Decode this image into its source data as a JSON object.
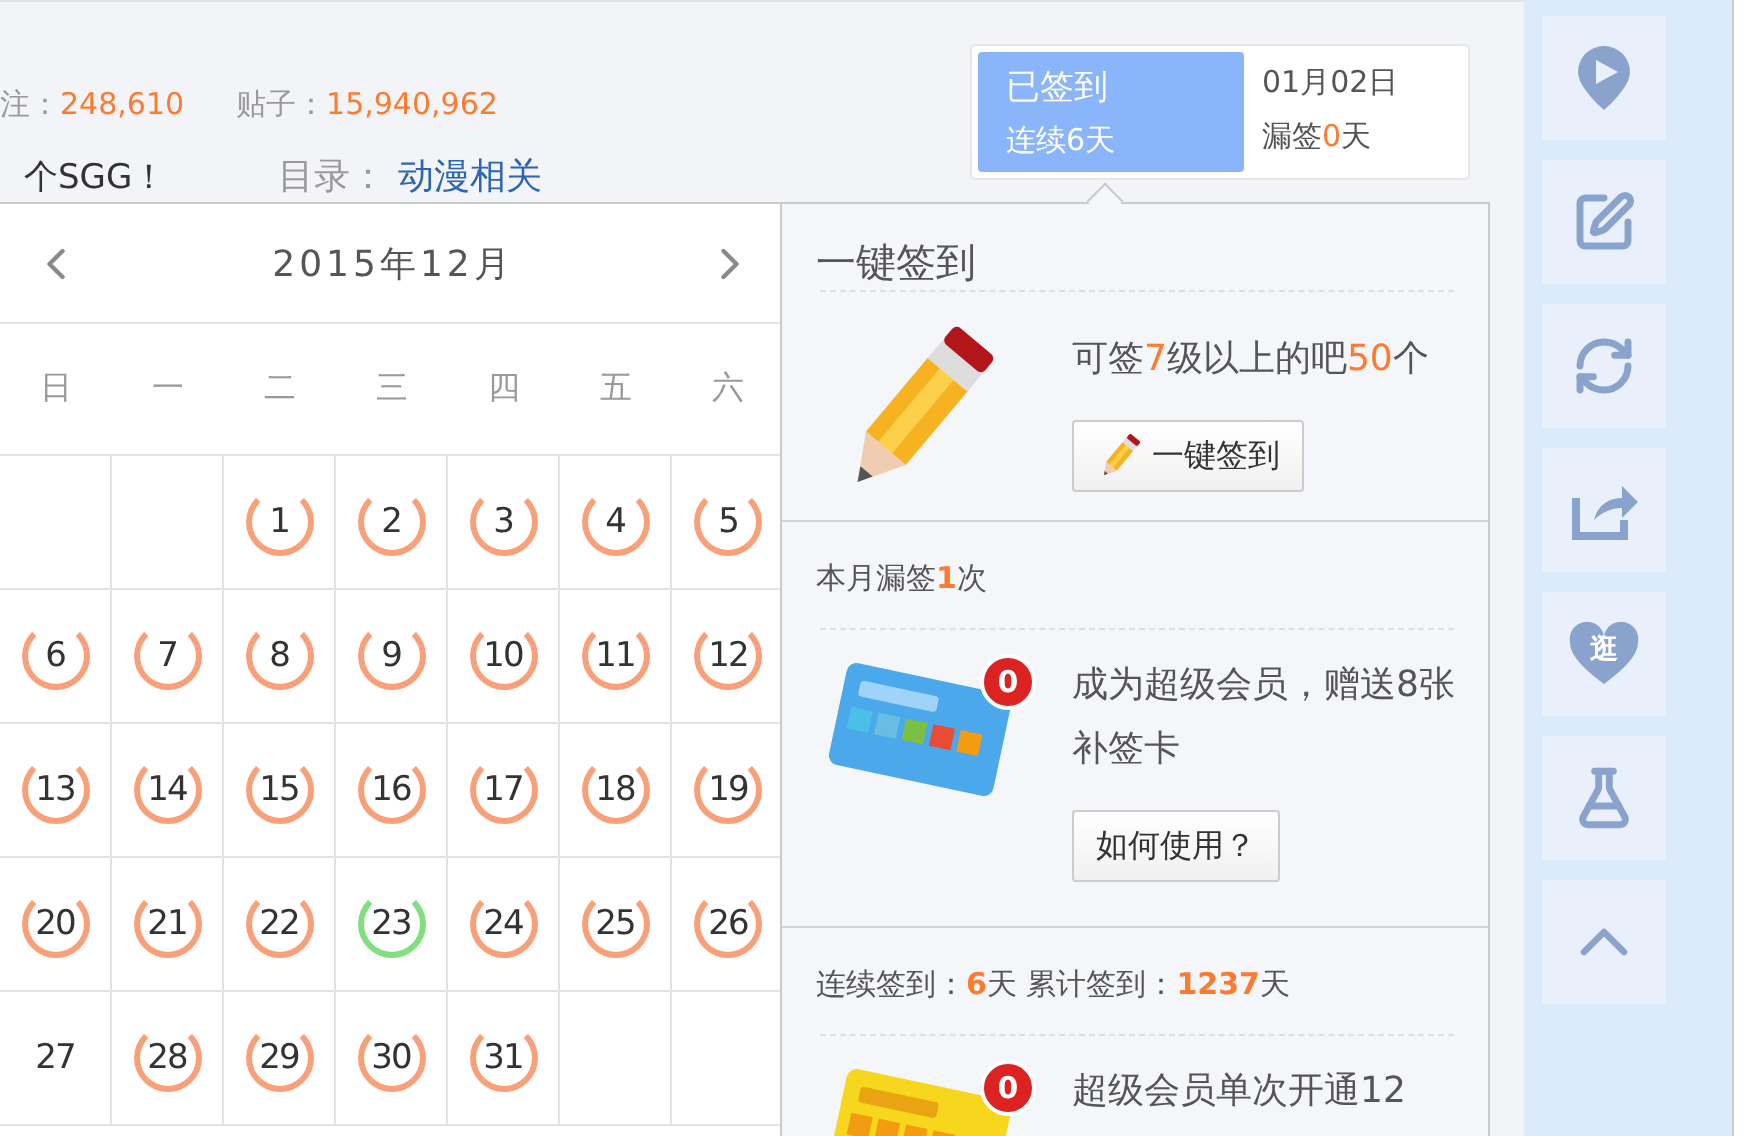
{
  "forum_stats": {
    "members_label": "注：",
    "members": "248,610",
    "posts_label": "贴子：",
    "posts": "15,940,962"
  },
  "forum_info": {
    "slogan": "个SGG！",
    "category_label": "目录：",
    "category": "动漫相关"
  },
  "sign_in": {
    "signed": true,
    "status": "已签到",
    "streak": "连续6天",
    "date": "01月02日",
    "missed": [
      {
        "text": "漏签",
        "highlight": false
      },
      {
        "text": "0",
        "highlight": true
      },
      {
        "text": "天",
        "highlight": false
      }
    ]
  },
  "calendar": {
    "title": "2015年12月",
    "weekdays": [
      "日",
      "一",
      "二",
      "三",
      "四",
      "五",
      "六"
    ],
    "weeks": [
      [
        {
          "kind": "blank"
        },
        {
          "kind": "blank"
        },
        {
          "kind": "day",
          "day": "1",
          "signed": true,
          "color": "#f9a079"
        },
        {
          "kind": "day",
          "day": "2",
          "signed": true,
          "color": "#f9a079"
        },
        {
          "kind": "day",
          "day": "3",
          "signed": true,
          "color": "#f9a079"
        },
        {
          "kind": "day",
          "day": "4",
          "signed": true,
          "color": "#f9a079"
        },
        {
          "kind": "day",
          "day": "5",
          "signed": true,
          "color": "#f9a079"
        }
      ],
      [
        {
          "kind": "day",
          "day": "6",
          "signed": true,
          "color": "#f9a079"
        },
        {
          "kind": "day",
          "day": "7",
          "signed": true,
          "color": "#f9a079"
        },
        {
          "kind": "day",
          "day": "8",
          "signed": true,
          "color": "#f9a079"
        },
        {
          "kind": "day",
          "day": "9",
          "signed": true,
          "color": "#f9a079"
        },
        {
          "kind": "day",
          "day": "10",
          "signed": true,
          "color": "#f9a079"
        },
        {
          "kind": "day",
          "day": "11",
          "signed": true,
          "color": "#f9a079"
        },
        {
          "kind": "day",
          "day": "12",
          "signed": true,
          "color": "#f9a079"
        }
      ],
      [
        {
          "kind": "day",
          "day": "13",
          "signed": true,
          "color": "#f9a079"
        },
        {
          "kind": "day",
          "day": "14",
          "signed": true,
          "color": "#f9a079"
        },
        {
          "kind": "day",
          "day": "15",
          "signed": true,
          "color": "#f9a079"
        },
        {
          "kind": "day",
          "day": "16",
          "signed": true,
          "color": "#f9a079"
        },
        {
          "kind": "day",
          "day": "17",
          "signed": true,
          "color": "#f9a079"
        },
        {
          "kind": "day",
          "day": "18",
          "signed": true,
          "color": "#f9a079"
        },
        {
          "kind": "day",
          "day": "19",
          "signed": true,
          "color": "#f9a079"
        }
      ],
      [
        {
          "kind": "day",
          "day": "20",
          "signed": true,
          "color": "#f9a079"
        },
        {
          "kind": "day",
          "day": "21",
          "signed": true,
          "color": "#f9a079"
        },
        {
          "kind": "day",
          "day": "22",
          "signed": true,
          "color": "#f9a079"
        },
        {
          "kind": "day",
          "day": "23",
          "signed": true,
          "color": "#80e080"
        },
        {
          "kind": "day",
          "day": "24",
          "signed": true,
          "color": "#f9a079"
        },
        {
          "kind": "day",
          "day": "25",
          "signed": true,
          "color": "#f9a079"
        },
        {
          "kind": "day",
          "day": "26",
          "signed": true,
          "color": "#f9a079"
        }
      ],
      [
        {
          "kind": "day",
          "day": "27",
          "signed": false
        },
        {
          "kind": "day",
          "day": "28",
          "signed": true,
          "color": "#f9a079"
        },
        {
          "kind": "day",
          "day": "29",
          "signed": true,
          "color": "#f9a079"
        },
        {
          "kind": "day",
          "day": "30",
          "signed": true,
          "color": "#f9a079"
        },
        {
          "kind": "day",
          "day": "31",
          "signed": true,
          "color": "#f9a079"
        },
        {
          "kind": "blank"
        },
        {
          "kind": "blank"
        }
      ]
    ]
  },
  "sign_panel": {
    "title": "一键签到",
    "sections": [
      {
        "kind": "batch",
        "text": [
          {
            "text": "可签",
            "highlight": false
          },
          {
            "text": "7",
            "highlight": true
          },
          {
            "text": "级以上的吧",
            "highlight": false
          },
          {
            "text": "50",
            "highlight": true
          },
          {
            "text": "个",
            "highlight": false
          }
        ],
        "button": "一键签到"
      },
      {
        "kind": "makeup_card",
        "heading": [
          {
            "text": "本月漏签",
            "highlight": false
          },
          {
            "text": "1",
            "highlight": true
          },
          {
            "text": "次",
            "highlight": false
          }
        ],
        "badge": "0",
        "text": [
          {
            "text": "成为超级会员，赠送8张补签卡",
            "highlight": false
          }
        ],
        "button": "如何使用？"
      },
      {
        "kind": "streak_card",
        "heading": [
          {
            "text": "连续签到：",
            "highlight": false
          },
          {
            "text": "6",
            "highlight": true
          },
          {
            "text": "天  累计签到：",
            "highlight": false
          },
          {
            "text": "1237",
            "highlight": true
          },
          {
            "text": "天",
            "highlight": false
          }
        ],
        "badge": "0",
        "text": [
          {
            "text": "超级会员单次开通12",
            "highlight": false
          }
        ]
      }
    ]
  },
  "sidebar": [
    {
      "kind": "location"
    },
    {
      "kind": "edit"
    },
    {
      "kind": "refresh"
    },
    {
      "kind": "share"
    },
    {
      "kind": "stroll",
      "label": "逛"
    },
    {
      "kind": "lab"
    },
    {
      "kind": "top"
    }
  ]
}
